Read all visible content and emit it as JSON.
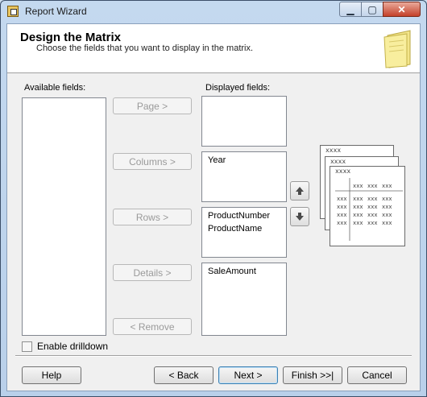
{
  "window": {
    "title": "Report Wizard",
    "minimize": "▁",
    "maximize": "▢",
    "close": "✕"
  },
  "header": {
    "title": "Design the Matrix",
    "subtitle": "Choose the fields that you want to display in the matrix."
  },
  "available": {
    "label": "Available fields:",
    "items": []
  },
  "displayed": {
    "label": "Displayed fields:",
    "page": [],
    "columns": [
      "Year"
    ],
    "rows": [
      "ProductNumber",
      "ProductName"
    ],
    "details": [
      "SaleAmount"
    ]
  },
  "buttons": {
    "page": "Page >",
    "columns": "Columns >",
    "rows": "Rows >",
    "details": "Details >",
    "remove": "< Remove",
    "move_up": "up-arrow-icon",
    "move_down": "down-arrow-icon"
  },
  "preview": {
    "header_marker": "xxxx",
    "cell": "xxx"
  },
  "drilldown": {
    "label": "Enable drilldown",
    "checked": false
  },
  "footer": {
    "help": "Help",
    "back": "< Back",
    "next": "Next >",
    "finish": "Finish >>|",
    "cancel": "Cancel"
  }
}
